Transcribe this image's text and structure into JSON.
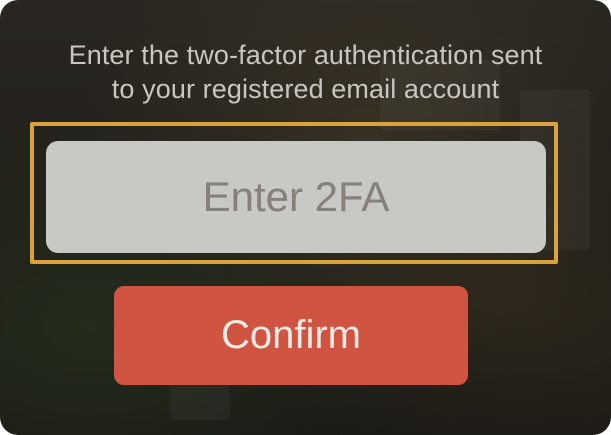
{
  "dialog": {
    "message_line1": "Enter the two-factor authentication sent",
    "message_line2": "to your registered email account",
    "code_input": {
      "value": "",
      "placeholder": "Enter 2FA"
    },
    "confirm_label": "Confirm"
  },
  "colors": {
    "highlight_border": "#d9a23a",
    "confirm_button": "#cf5442",
    "input_background": "#c8c8c5"
  }
}
